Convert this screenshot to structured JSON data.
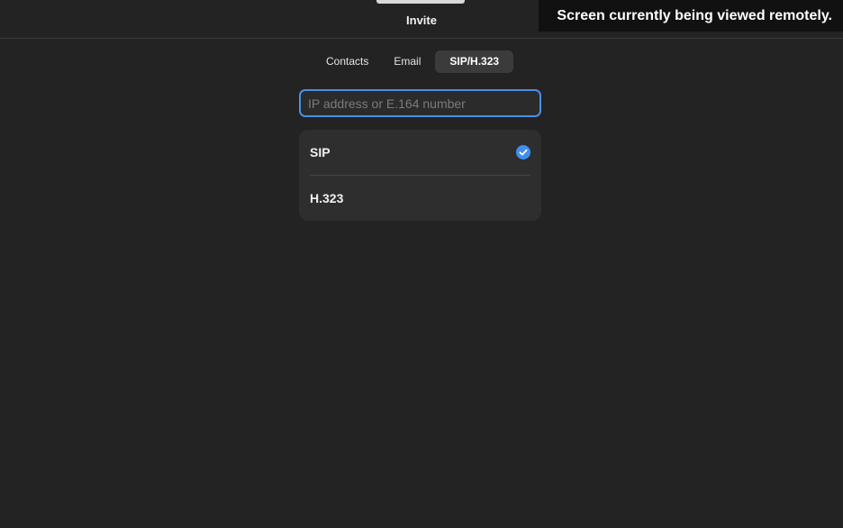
{
  "header": {
    "title": "Invite"
  },
  "banner": {
    "text": "Screen currently being viewed remotely."
  },
  "tabs": [
    {
      "label": "Contacts",
      "active": false
    },
    {
      "label": "Email",
      "active": false
    },
    {
      "label": "SIP/H.323",
      "active": true
    }
  ],
  "address_input": {
    "value": "",
    "placeholder": "IP address or E.164 number"
  },
  "protocols": [
    {
      "label": "SIP",
      "selected": true
    },
    {
      "label": "H.323",
      "selected": false
    }
  ],
  "colors": {
    "background": "#232323",
    "accent": "#4a8fe7",
    "check": "#3f8ef0"
  },
  "icons": {
    "selected_indicator": "check-circle-icon"
  }
}
